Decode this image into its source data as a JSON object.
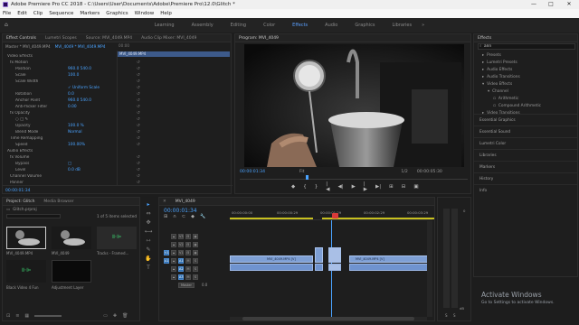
{
  "titlebar": {
    "title": "Adobe Premiere Pro CC 2018 - C:\\Users\\User\\Documents\\Adobe\\Premiere Pro\\12.0\\Glitch *",
    "min": "—",
    "max": "□",
    "close": "✕"
  },
  "menu": [
    "File",
    "Edit",
    "Clip",
    "Sequence",
    "Markers",
    "Graphics",
    "Window",
    "Help"
  ],
  "workspaces": [
    "Learning",
    "Assembly",
    "Editing",
    "Color",
    "Effects",
    "Audio",
    "Graphics",
    "Libraries"
  ],
  "effect_controls": {
    "tabs": [
      "Effect Controls",
      "Lumetri Scopes",
      "Source: MVI_4049.MP4",
      "Audio Clip Mixer: MVI_4049"
    ],
    "master": "Master * MVI_4049.MP4",
    "clip": "MVI_4049 * MVI_4049.MP4",
    "ruler": "00:00",
    "clip_chip": "MVI_4049.MP4",
    "rows": [
      {
        "label": "Video Effects",
        "indent": 1,
        "value": ""
      },
      {
        "label": "fx  Motion",
        "indent": 2,
        "value": ""
      },
      {
        "label": "Position",
        "indent": 4,
        "value": "960.0    540.0"
      },
      {
        "label": "Scale",
        "indent": 4,
        "value": "100.0"
      },
      {
        "label": "Scale Width",
        "indent": 4,
        "value": ""
      },
      {
        "label": "",
        "indent": 4,
        "value": "✓ Uniform Scale"
      },
      {
        "label": "Rotation",
        "indent": 4,
        "value": "0.0"
      },
      {
        "label": "Anchor Point",
        "indent": 4,
        "value": "960.0    540.0"
      },
      {
        "label": "Anti-flicker Filter",
        "indent": 4,
        "value": "0.00"
      },
      {
        "label": "fx  Opacity",
        "indent": 2,
        "value": ""
      },
      {
        "label": "○ □ ✎",
        "indent": 4,
        "value": ""
      },
      {
        "label": "Opacity",
        "indent": 4,
        "value": "100.0 %"
      },
      {
        "label": "Blend Mode",
        "indent": 4,
        "value": "Normal"
      },
      {
        "label": "Time Remapping",
        "indent": 2,
        "value": ""
      },
      {
        "label": "Speed",
        "indent": 4,
        "value": "100.00%"
      },
      {
        "label": "Audio Effects",
        "indent": 1,
        "value": ""
      },
      {
        "label": "fx  Volume",
        "indent": 2,
        "value": ""
      },
      {
        "label": "Bypass",
        "indent": 4,
        "value": "□"
      },
      {
        "label": "Level",
        "indent": 4,
        "value": "0.0 dB"
      },
      {
        "label": "Channel Volume",
        "indent": 2,
        "value": ""
      },
      {
        "label": "Panner",
        "indent": 2,
        "value": ""
      }
    ],
    "timecode": "00:00:01:34"
  },
  "program": {
    "tab": "Program: MVI_4049",
    "timecode": "00:00:01:34",
    "fit": "Fit",
    "quality": "1/2",
    "duration": "00:00:05:30",
    "controls": [
      "◆",
      "{",
      "}",
      "|◀",
      "◀|",
      "▶",
      "|▶",
      "▶|",
      "⊞",
      "⊟",
      "▣",
      "✚"
    ]
  },
  "project": {
    "tabs": [
      "Project: Glitch",
      "Media Browser"
    ],
    "folder": "Glitch.prproj",
    "count": "1 of 5 items selected",
    "items": [
      {
        "label": "MVI_4049.MP4",
        "dur": "6:10"
      },
      {
        "label": "MVI_4049",
        "dur": "6:10"
      },
      {
        "label": "Tracks - Framed...",
        "dur": ""
      },
      {
        "label": "Black Video 4 Fun",
        "dur": ""
      },
      {
        "label": "Adjustment Layer",
        "dur": ""
      }
    ]
  },
  "tools": [
    "▸",
    "⇔",
    "✥",
    "⟷",
    "⇿",
    "✎",
    "✋",
    "T"
  ],
  "timeline": {
    "tab": "MVI_4049",
    "timecode": "00:00:01:34",
    "ruler": [
      "00:00:00:00",
      "00:00:00:29",
      "00:00:01:29",
      "00:00:02:29",
      "00:00:03:29"
    ],
    "tracks": [
      {
        "name": "V3",
        "kind": "video"
      },
      {
        "name": "V2",
        "kind": "video"
      },
      {
        "name": "V1",
        "kind": "video"
      },
      {
        "name": "A1",
        "kind": "audio"
      },
      {
        "name": "A2",
        "kind": "audio"
      },
      {
        "name": "A3",
        "kind": "audio"
      },
      {
        "name": "Master",
        "kind": "master"
      }
    ],
    "master_val": "0.0",
    "clip_label": "MVI_4049.MP4 [V]"
  },
  "effects": {
    "tab": "Effects",
    "search": "ann",
    "tree": [
      "Presets",
      "Lumetri Presets",
      "Audio Effects",
      "Audio Transitions",
      "Video Effects",
      "Channel",
      "Arithmetic",
      "Compound Arithmetic",
      "Video Transitions"
    ],
    "sections": [
      "Essential Graphics",
      "Essential Sound",
      "Lumetri Color",
      "Libraries",
      "Markers",
      "History",
      "Info"
    ]
  },
  "audio_meter": {
    "db_top": "0",
    "db_bottom": "dB",
    "solo": "S"
  },
  "watermark": {
    "line1": "Activate Windows",
    "line2": "Go to Settings to activate Windows."
  }
}
